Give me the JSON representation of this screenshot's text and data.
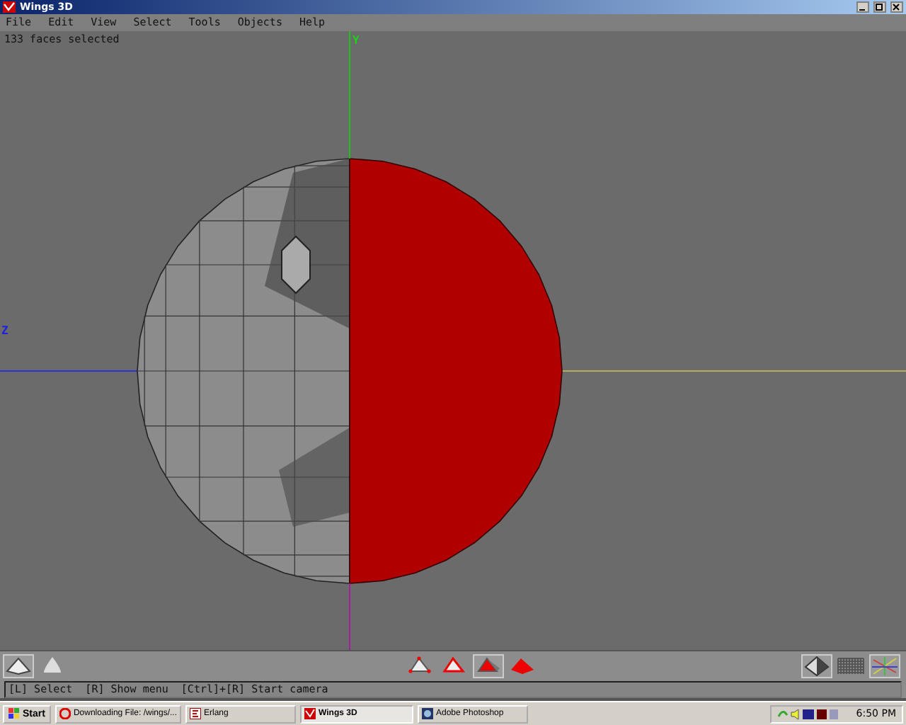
{
  "window": {
    "title": "Wings 3D"
  },
  "menu": [
    "File",
    "Edit",
    "View",
    "Select",
    "Tools",
    "Objects",
    "Help"
  ],
  "viewport": {
    "info": "133 faces selected",
    "axis_labels": [
      {
        "kind": "y",
        "label": "Y"
      },
      {
        "kind": "z",
        "label": "Z"
      }
    ]
  },
  "toolbar": {
    "select_modes": [
      {
        "kind": "vertex",
        "selected": false
      },
      {
        "kind": "edge",
        "selected": false
      },
      {
        "kind": "face",
        "selected": true
      },
      {
        "kind": "body",
        "selected": false
      }
    ],
    "views": [
      {
        "kind": "shade",
        "selected": true
      },
      {
        "kind": "wire",
        "selected": false
      },
      {
        "kind": "axes",
        "selected": true
      }
    ],
    "shapes": [
      {
        "kind": "pyramid",
        "selected": true
      },
      {
        "kind": "cone",
        "selected": false
      }
    ]
  },
  "status": "[L] Select  [R] Show menu  [Ctrl]+[R] Start camera",
  "taskbar": {
    "start": "Start",
    "tasks": [
      {
        "kind": "browser",
        "label": "Downloading File: /wings/...",
        "selected": false
      },
      {
        "kind": "erlang",
        "label": "Erlang",
        "selected": false
      },
      {
        "kind": "wings",
        "label": "Wings 3D",
        "selected": true
      },
      {
        "kind": "photoshop",
        "label": "Adobe Photoshop",
        "selected": false
      }
    ],
    "clock": "6:50 PM"
  }
}
